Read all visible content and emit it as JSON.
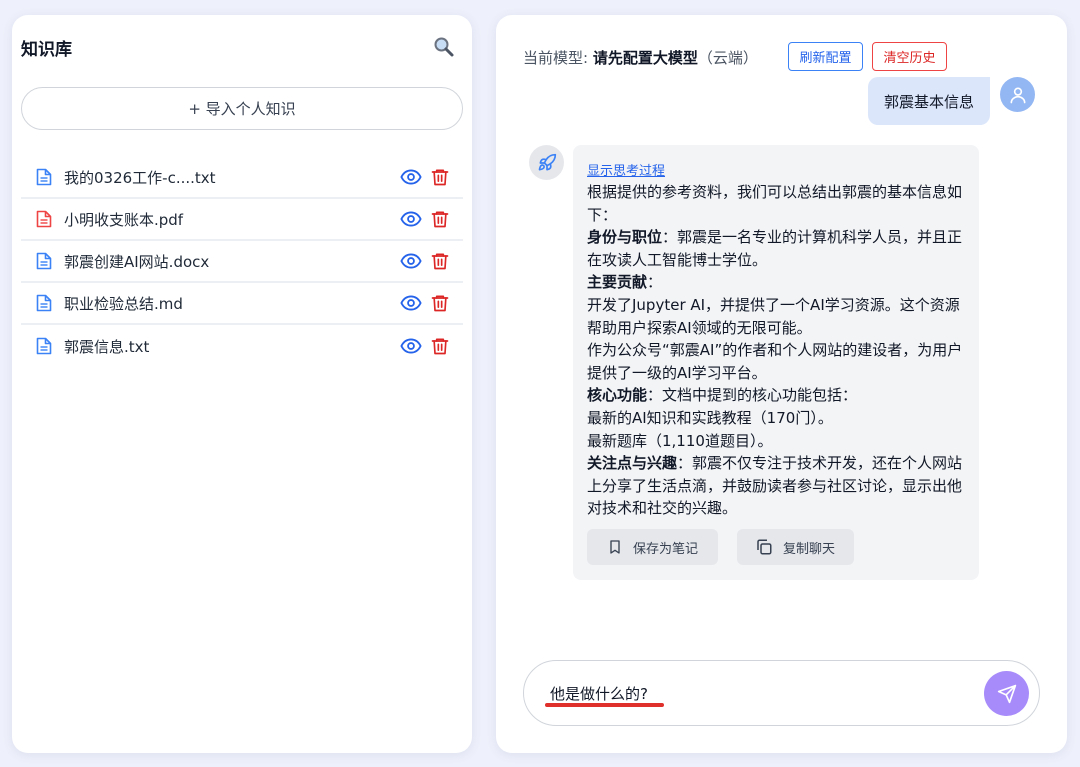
{
  "knowledge": {
    "title": "知识库",
    "import_label": "+ 导入个人知识",
    "files": [
      {
        "name": "我的0326工作-c....txt",
        "color": "#3b82f6"
      },
      {
        "name": "小明收支账本.pdf",
        "color": "#ef4444"
      },
      {
        "name": "郭震创建AI网站.docx",
        "color": "#3b82f6"
      },
      {
        "name": "职业检验总结.md",
        "color": "#3b82f6"
      },
      {
        "name": "郭震信息.txt",
        "color": "#3b82f6"
      }
    ]
  },
  "chat": {
    "model_prefix": "当前模型: ",
    "model_name": "请先配置大模型",
    "model_suffix": "（云端）",
    "refresh_label": "刷新配置",
    "clear_label": "清空历史",
    "user_message": "郭震基本信息",
    "think_link": "显示思考过程",
    "answer": {
      "intro": "根据提供的参考资料，我们可以总结出郭震的基本信息如下：",
      "identity_title": "身份与职位",
      "identity_text": "：郭震是一名专业的计算机科学人员，并且正在攻读人工智能博士学位。",
      "contrib_title": "主要贡献",
      "contrib_colon": "：",
      "contrib_1": "开发了Jupyter AI，并提供了一个AI学习资源。这个资源帮助用户探索AI领域的无限可能。",
      "contrib_2": "作为公众号“郭震AI”的作者和个人网站的建设者，为用户提供了一级的AI学习平台。",
      "core_title": "核心功能",
      "core_text": "：文档中提到的核心功能包括：",
      "core_1": "最新的AI知识和实践教程（170门）。",
      "core_2": "最新题库（1,110道题目）。",
      "interest_title": "关注点与兴趣",
      "interest_text": "：郭震不仅专注于技术开发，还在个人网站上分享了生活点滴，并鼓励读者参与社区讨论，显示出他对技术和社交的兴趣。"
    },
    "save_label": "保存为笔记",
    "copy_label": "复制聊天",
    "input_value": "他是做什么的?"
  },
  "colors": {
    "accent": "#3b82f6",
    "danger": "#ef4444",
    "send": "#a78bfa",
    "user_bubble": "#dbe6fb"
  }
}
